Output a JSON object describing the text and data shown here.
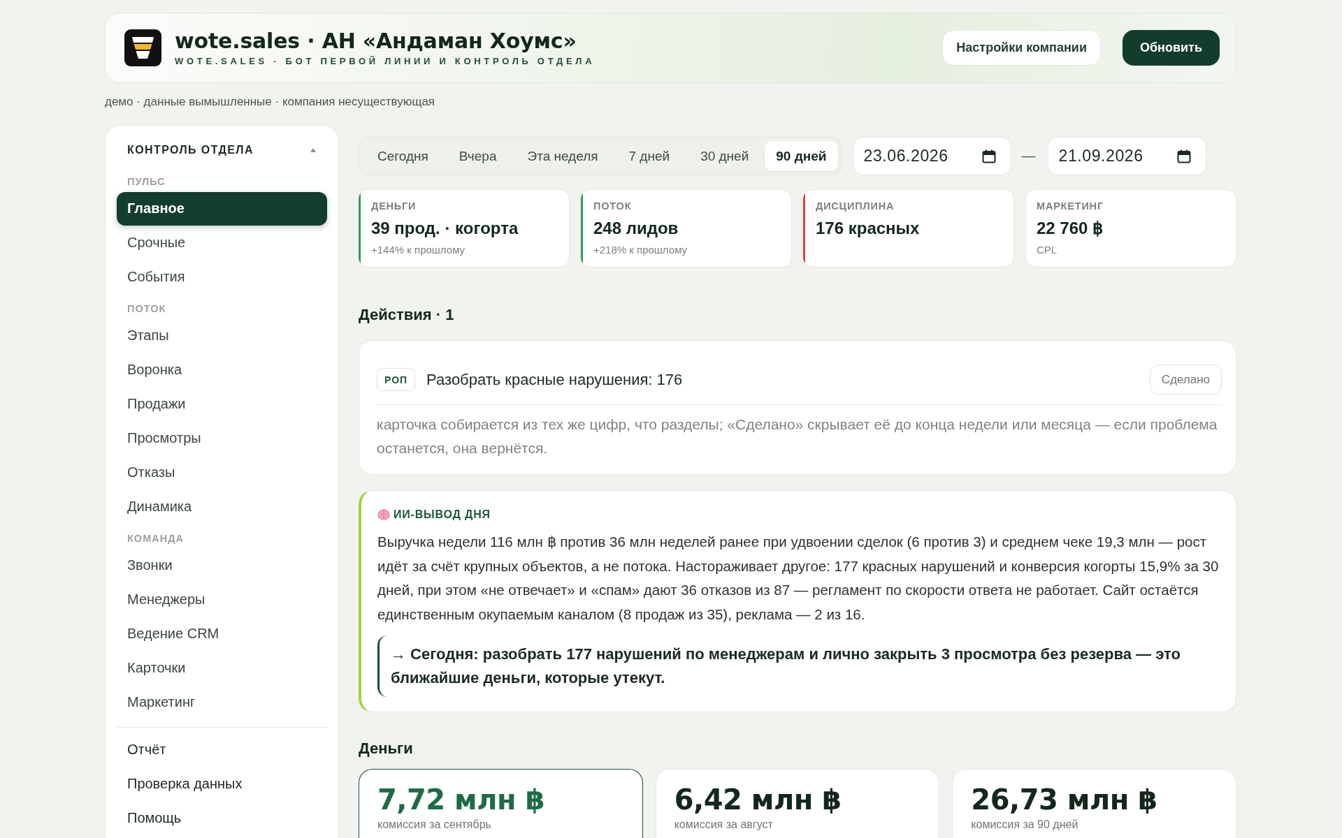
{
  "header": {
    "title": "wote.sales · АН «Андаман Хоумс»",
    "subtitle": "WOTE.SALES · БОТ ПЕРВОЙ ЛИНИИ И КОНТРОЛЬ ОТДЕЛА",
    "buttons": [
      {
        "label": "Настройки компании",
        "kind": "secondary"
      },
      {
        "label": "Обновить",
        "kind": "primary"
      }
    ]
  },
  "demo_note": "демо · данные вымышленные · компания несуществующая",
  "sidebar": {
    "title": "КОНТРОЛЬ ОТДЕЛА",
    "expanded": true,
    "sections": [
      {
        "kind": "group",
        "label": "ПУЛЬС",
        "items": [
          {
            "label": "Главное",
            "selected": true
          },
          {
            "label": "Срочные",
            "selected": false
          },
          {
            "label": "События",
            "selected": false
          }
        ]
      },
      {
        "kind": "group",
        "label": "ПОТОК",
        "items": [
          {
            "label": "Этапы",
            "selected": false
          },
          {
            "label": "Воронка",
            "selected": false
          },
          {
            "label": "Продажи",
            "selected": false
          },
          {
            "label": "Просмотры",
            "selected": false
          },
          {
            "label": "Отказы",
            "selected": false
          },
          {
            "label": "Динамика",
            "selected": false
          }
        ]
      },
      {
        "kind": "group",
        "label": "КОМАНДА",
        "items": [
          {
            "label": "Звонки",
            "selected": false
          },
          {
            "label": "Менеджеры",
            "selected": false
          },
          {
            "label": "Ведение CRM",
            "selected": false
          },
          {
            "label": "Карточки",
            "selected": false
          },
          {
            "label": "Маркетинг",
            "selected": false
          }
        ]
      },
      {
        "kind": "footer",
        "items": [
          {
            "label": "Отчёт",
            "selected": false
          },
          {
            "label": "Проверка данных",
            "selected": false
          },
          {
            "label": "Помощь",
            "selected": false
          }
        ]
      }
    ]
  },
  "filters": {
    "periods": [
      {
        "label": "Сегодня",
        "selected": false
      },
      {
        "label": "Вчера",
        "selected": false
      },
      {
        "label": "Эта неделя",
        "selected": false
      },
      {
        "label": "7 дней",
        "selected": false
      },
      {
        "label": "30 дней",
        "selected": false
      },
      {
        "label": "90 дней",
        "selected": true
      }
    ],
    "date_from": "23.06.2026",
    "separator": "—",
    "date_to": "21.09.2026"
  },
  "kpis": [
    {
      "label": "ДЕНЬГИ",
      "value": "39 прод. · когорта",
      "note": "+144% к прошлому",
      "color": "#2f9a58"
    },
    {
      "label": "ПОТОК",
      "value": "248 лидов",
      "note": "+218% к прошлому",
      "color": "#2f9a58"
    },
    {
      "label": "ДИСЦИПЛИНА",
      "value": "176 красных",
      "color": "#d6473b"
    },
    {
      "label": "МАРКЕТИНГ",
      "value": "22 760 ฿",
      "note": "CPL"
    }
  ],
  "actions": {
    "title": "Действия · 1",
    "items": [
      {
        "tag": "РОП",
        "title": "Разобрать красные нарушения: 176",
        "button": "Сделано",
        "description": "карточка собирается из тех же цифр, что разделы; «Сделано» скрывает её до конца недели или месяца — если проблема останется, она вернётся."
      }
    ]
  },
  "ai_summary": {
    "label": "ИИ-ВЫВОД ДНЯ",
    "text": "Выручка недели 116 млн ฿ против 36 млн неделей ранее при удвоении сделок (6 против 3) и среднем чеке 19,3 млн — рост идёт за счёт крупных объектов, а не потока. Настораживает другое: 177 красных нарушений и конверсия когорты 15,9% за 30 дней, при этом «не отвечает» и «спам» дают 36 отказов из 87 — регламент по скорости ответа не работает. Сайт остаётся единственным окупаемым каналом (8 продаж из 35), реклама — 2 из 16.",
    "conclusion": "→ Сегодня: разобрать 177 нарушений по менеджерам и лично закрыть 3 просмотра без резерва — это ближайшие деньги, которые утекут."
  },
  "money": {
    "title": "Деньги",
    "cards": [
      {
        "value": "7,72 млн ฿",
        "caption": "комиссия за сентябрь",
        "selected": true
      },
      {
        "value": "6,42 млн ฿",
        "caption": "комиссия за август",
        "selected": false
      },
      {
        "value": "26,73 млн ฿",
        "caption": "комиссия за 90 дней",
        "selected": false
      }
    ]
  }
}
